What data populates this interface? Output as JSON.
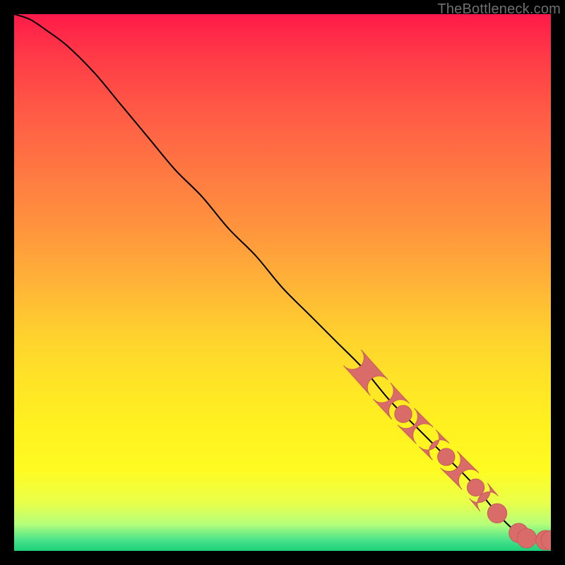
{
  "watermark": "TheBottleneck.com",
  "colors": {
    "curve": "#000000",
    "marker_fill": "#d96b68",
    "marker_stroke": "#c95a58",
    "gradient_stops": [
      "#ff1a49",
      "#ff5a45",
      "#ff9a3c",
      "#ffd22e",
      "#fffb22",
      "#b6ff7a",
      "#1cd07a"
    ]
  },
  "chart_data": {
    "type": "line",
    "title": "",
    "xlabel": "",
    "ylabel": "",
    "xlim": [
      0,
      100
    ],
    "ylim": [
      0,
      100
    ],
    "series": [
      {
        "name": "curve",
        "x": [
          0,
          3,
          6,
          10,
          15,
          20,
          25,
          30,
          35,
          40,
          45,
          50,
          55,
          60,
          65,
          70,
          75,
          80,
          85,
          90,
          93,
          96,
          98,
          100
        ],
        "y": [
          100,
          99,
          97,
          94,
          89,
          83,
          77,
          71,
          66,
          60,
          55,
          49,
          44,
          39,
          34,
          28,
          23,
          18,
          13,
          7,
          4,
          2,
          2,
          2
        ]
      }
    ],
    "markers": [
      {
        "shape": "pill",
        "along": "curve",
        "x0": 63,
        "x1": 68,
        "r": 2.2
      },
      {
        "shape": "pill",
        "along": "curve",
        "x0": 68.5,
        "x1": 72,
        "r": 2.2
      },
      {
        "shape": "dot",
        "along": "curve",
        "x": 72.5,
        "r": 1.6
      },
      {
        "shape": "pill",
        "along": "curve",
        "x0": 73,
        "x1": 76.5,
        "r": 2.2
      },
      {
        "shape": "pill",
        "along": "curve",
        "x0": 77,
        "x1": 79.5,
        "r": 2.2
      },
      {
        "shape": "dot",
        "along": "curve",
        "x": 80.5,
        "r": 1.6
      },
      {
        "shape": "pill",
        "along": "curve",
        "x0": 81,
        "x1": 85,
        "r": 2.2
      },
      {
        "shape": "dot",
        "along": "curve",
        "x": 86,
        "r": 1.6
      },
      {
        "shape": "pill",
        "along": "curve",
        "x0": 86.5,
        "x1": 88.5,
        "r": 2.2
      },
      {
        "shape": "dot",
        "along": "curve",
        "x": 90,
        "r": 1.8
      },
      {
        "shape": "dot",
        "along": "curve",
        "x": 94,
        "r": 1.8
      },
      {
        "shape": "dot",
        "along": "curve",
        "x": 95.5,
        "r": 1.8
      },
      {
        "shape": "dot",
        "along": "curve",
        "x": 99,
        "r": 1.8
      },
      {
        "shape": "dot",
        "along": "curve",
        "x": 100,
        "r": 1.8
      }
    ]
  }
}
